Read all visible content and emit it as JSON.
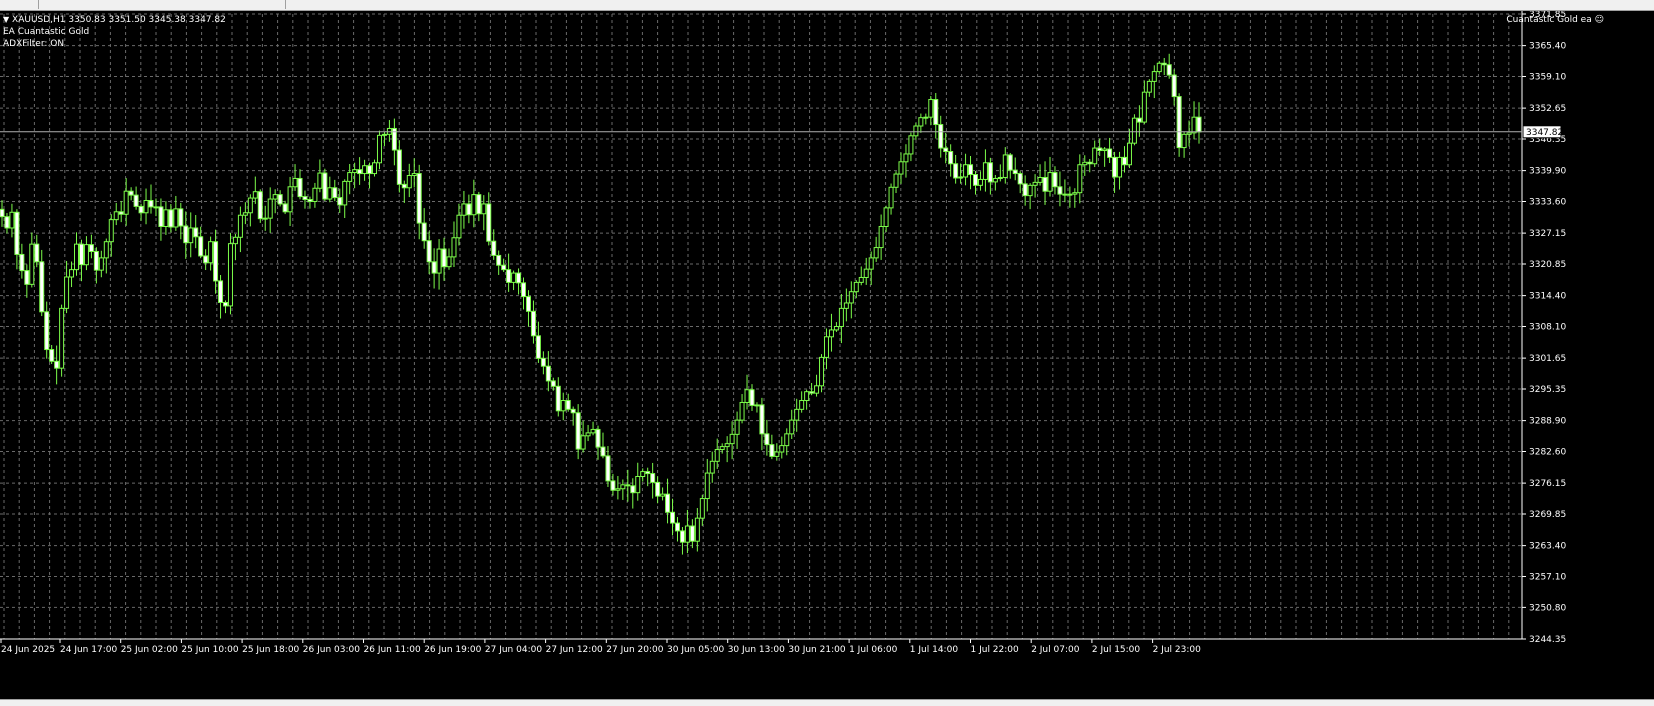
{
  "window": {
    "symbol_line": "XAUUSD,H1  3350.83 3351.50 3345.38 3347.82",
    "ea_line": "EA Cuantastic Gold",
    "filter_line": "ADXFilter: ON",
    "ea_badge": "Cuantastic Gold ea",
    "ea_badge_icon": "smiley-icon",
    "dropdown_icon": "triangle-down-icon"
  },
  "colors": {
    "background": "#000000",
    "grid": "#6a6a6a",
    "candle": "#7CFC4A",
    "bull_body": "#000000",
    "bear_body": "#ffffff",
    "price_line": "#b0b0b0"
  },
  "chart_data": {
    "type": "candlestick",
    "symbol": "XAUUSD",
    "timeframe": "H1",
    "current_price": 3347.82,
    "current_price_label": "3347.82",
    "ylim": [
      3244.35,
      3371.85
    ],
    "grid": true,
    "y_ticks": [
      "3371.85",
      "3365.40",
      "3359.10",
      "3352.65",
      "3346.35",
      "3339.90",
      "3333.60",
      "3327.15",
      "3320.85",
      "3314.40",
      "3308.10",
      "3301.65",
      "3295.35",
      "3288.90",
      "3282.60",
      "3276.15",
      "3269.85",
      "3263.40",
      "3257.10",
      "3250.80",
      "3244.35"
    ],
    "x_ticks": [
      "24 Jun 2025",
      "24 Jun 17:00",
      "25 Jun 02:00",
      "25 Jun 10:00",
      "25 Jun 18:00",
      "26 Jun 03:00",
      "26 Jun 11:00",
      "26 Jun 19:00",
      "27 Jun 04:00",
      "27 Jun 12:00",
      "27 Jun 20:00",
      "30 Jun 05:00",
      "30 Jun 13:00",
      "30 Jun 21:00",
      "1 Jul 06:00",
      "1 Jul 14:00",
      "1 Jul 22:00",
      "2 Jul 07:00",
      "2 Jul 15:00",
      "2 Jul 23:00"
    ],
    "closes": [
      3330.5,
      3328.2,
      3331.4,
      3322.8,
      3319.5,
      3316.7,
      3324.9,
      3321.3,
      3311.1,
      3303.4,
      3301.0,
      3299.6,
      3311.8,
      3318.2,
      3319.7,
      3324.9,
      3320.7,
      3324.8,
      3323.4,
      3319.6,
      3322.1,
      3325.4,
      3329.9,
      3331.5,
      3331.0,
      3335.7,
      3334.9,
      3332.6,
      3331.3,
      3333.8,
      3332.5,
      3332.5,
      3328.5,
      3331.9,
      3328.4,
      3332.1,
      3328.6,
      3325.2,
      3328.2,
      3326.4,
      3322.5,
      3321.1,
      3325.4,
      3317.4,
      3313.0,
      3312.3,
      3325.0,
      3326.3,
      3330.8,
      3331.3,
      3334.3,
      3335.6,
      3330.1,
      3330.2,
      3334.1,
      3335.0,
      3333.1,
      3331.5,
      3336.6,
      3338.3,
      3334.6,
      3334.0,
      3333.6,
      3336.3,
      3339.4,
      3334.1,
      3336.4,
      3334.4,
      3332.9,
      3337.7,
      3339.5,
      3340.1,
      3339.3,
      3340.9,
      3339.3,
      3341.5,
      3347.1,
      3347.3,
      3348.5,
      3344.1,
      3337.1,
      3336.4,
      3338.9,
      3339.3,
      3329.2,
      3325.6,
      3321.3,
      3319.0,
      3323.9,
      3320.3,
      3322.3,
      3326.2,
      3330.8,
      3333.1,
      3330.9,
      3335.0,
      3331.1,
      3333.1,
      3325.5,
      3322.6,
      3320.6,
      3319.7,
      3317.1,
      3319.0,
      3317.0,
      3314.2,
      3311.2,
      3306.2,
      3301.6,
      3300.0,
      3297.0,
      3295.9,
      3290.9,
      3293.0,
      3291.2,
      3290.5,
      3283.1,
      3285.8,
      3286.4,
      3287.1,
      3283.5,
      3281.7,
      3276.6,
      3274.7,
      3275.0,
      3275.8,
      3275.6,
      3274.2,
      3277.5,
      3278.5,
      3278.1,
      3276.3,
      3273.5,
      3273.9,
      3270.2,
      3268.0,
      3266.4,
      3264.1,
      3267.4,
      3264.3,
      3269.0,
      3273.0,
      3278.2,
      3280.6,
      3283.0,
      3283.6,
      3284.2,
      3286.1,
      3289.0,
      3292.6,
      3295.2,
      3292.0,
      3292.1,
      3286.2,
      3284.0,
      3281.6,
      3282.5,
      3283.8,
      3286.2,
      3289.0,
      3291.2,
      3293.0,
      3294.8,
      3294.5,
      3296.0,
      3301.8,
      3306.0,
      3307.4,
      3308.1,
      3311.8,
      3312.9,
      3315.2,
      3317.1,
      3318.1,
      3319.8,
      3322.1,
      3324.2,
      3328.5,
      3332.3,
      3336.5,
      3339.2,
      3341.7,
      3343.3,
      3347.0,
      3349.0,
      3350.7,
      3350.8,
      3354.4,
      3349.3,
      3344.5,
      3343.8,
      3341.3,
      3338.4,
      3338.6,
      3341.1,
      3339.1,
      3336.9,
      3338.1,
      3341.5,
      3337.6,
      3338.3,
      3338.5,
      3343.1,
      3340.0,
      3339.3,
      3337.2,
      3334.8,
      3336.9,
      3337.5,
      3338.5,
      3335.7,
      3339.5,
      3336.6,
      3335.1,
      3335.1,
      3335.1,
      3335.4,
      3341.1,
      3341.6,
      3341.3,
      3344.5,
      3344.0,
      3344.3,
      3342.6,
      3338.6,
      3342.6,
      3341.1,
      3345.5,
      3350.6,
      3349.8,
      3355.9,
      3358.1,
      3360.1,
      3361.8,
      3361.5,
      3359.4,
      3355.0,
      3344.6,
      3347.3,
      3347.6,
      3350.8,
      3347.8
    ],
    "candles_sample": [
      {
        "o": 3332.0,
        "h": 3340.1,
        "l": 3320.4,
        "c": 3330.5
      }
    ]
  }
}
